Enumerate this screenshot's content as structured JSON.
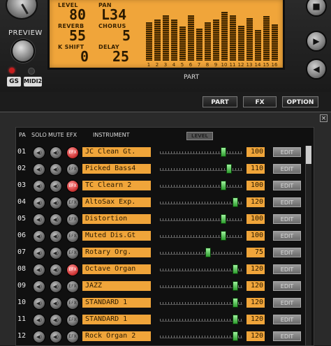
{
  "header": {
    "preview_label": "PREVIEW",
    "logo_gs": "GS",
    "logo_midi": "MIDI2",
    "part_label": "PART"
  },
  "lcd": {
    "level_label": "LEVEL",
    "level_value": "80",
    "pan_label": "PAN",
    "pan_value": "L34",
    "reverb_label": "REVERB",
    "reverb_value": "55",
    "chorus_label": "CHORUS",
    "chorus_value": "5",
    "kshift_label": "K SHIFT",
    "kshift_value": "0",
    "delay_label": "DELAY",
    "delay_value": "25",
    "part_numbers": [
      "1",
      "2",
      "3",
      "4",
      "5",
      "6",
      "7",
      "8",
      "9",
      "10",
      "11",
      "12",
      "13",
      "14",
      "15",
      "16"
    ],
    "part_levels": [
      0.72,
      0.78,
      0.86,
      0.78,
      0.64,
      0.86,
      0.6,
      0.72,
      0.78,
      0.92,
      0.86,
      0.66,
      0.8,
      0.58,
      0.84,
      0.68
    ]
  },
  "side_buttons": {
    "stop": "■",
    "play": "▶",
    "rewind": "◀"
  },
  "mode_buttons": {
    "part": "PART",
    "fx": "FX",
    "option": "OPTION"
  },
  "panel": {
    "close": "×"
  },
  "table": {
    "headers": {
      "part": "PA",
      "solo": "SOLO",
      "mute": "MUTE",
      "efx": "EFX",
      "instrument": "INSTRUMENT",
      "level_button": "LEVEL"
    },
    "solo_icon": "◀)",
    "mute_icon": "◀)",
    "efx_label": "EFX",
    "edit_label": "EDIT",
    "rows": [
      {
        "num": "01",
        "instrument": "JC Clean Gt.",
        "level": "100",
        "efx_on": true
      },
      {
        "num": "02",
        "instrument": "Picked Bass4",
        "level": "110",
        "efx_on": false
      },
      {
        "num": "03",
        "instrument": "TC Clearn 2",
        "level": "100",
        "efx_on": true
      },
      {
        "num": "04",
        "instrument": "AltoSax  Exp.",
        "level": "120",
        "efx_on": false
      },
      {
        "num": "05",
        "instrument": "Distortion",
        "level": "100",
        "efx_on": false
      },
      {
        "num": "06",
        "instrument": "Muted Dis.Gt",
        "level": "100",
        "efx_on": false
      },
      {
        "num": "07",
        "instrument": "Rotary Org.",
        "level": "75",
        "efx_on": false
      },
      {
        "num": "08",
        "instrument": "Octave Organ",
        "level": "120",
        "efx_on": true
      },
      {
        "num": "09",
        "instrument": "JAZZ",
        "level": "120",
        "efx_on": false
      },
      {
        "num": "10",
        "instrument": "STANDARD 1",
        "level": "120",
        "efx_on": false
      },
      {
        "num": "11",
        "instrument": "STANDARD 1",
        "level": "120",
        "efx_on": false
      },
      {
        "num": "12",
        "instrument": "Rock Organ 2",
        "level": "120",
        "efx_on": false
      }
    ]
  }
}
